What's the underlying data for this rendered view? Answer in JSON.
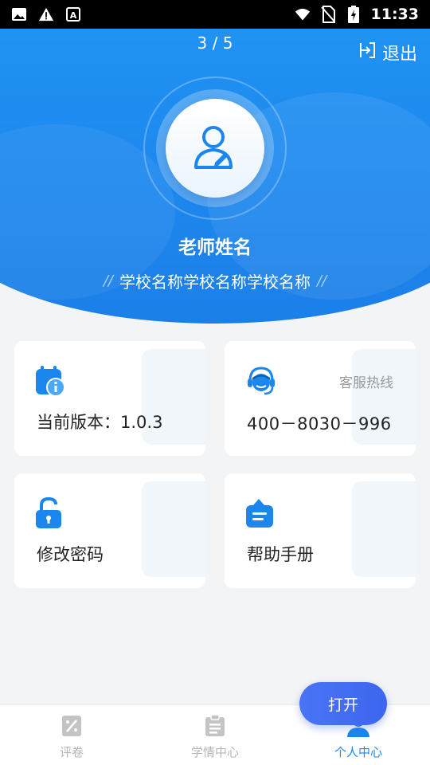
{
  "status_bar": {
    "time": "11:33",
    "left_icons": [
      "image-icon",
      "warning-icon",
      "font-icon"
    ],
    "right_icons": [
      "wifi-icon",
      "no-sim-icon",
      "battery-charging-icon"
    ]
  },
  "header": {
    "page_indicator": "3 / 5",
    "logout_label": "退出",
    "teacher_name": "老师姓名",
    "school_name": "学校名称学校名称学校名称"
  },
  "cards": {
    "version_label": "当前版本：1.0.3",
    "hotline_title": "客服热线",
    "hotline_number": "400－8030－996",
    "password_label": "修改密码",
    "help_label": "帮助手册"
  },
  "fab": {
    "label": "打开"
  },
  "tabs": [
    {
      "label": "评卷",
      "icon": "grading-icon",
      "active": false
    },
    {
      "label": "学情中心",
      "icon": "clipboard-icon",
      "active": false
    },
    {
      "label": "个人中心",
      "icon": "person-icon",
      "active": true
    }
  ],
  "colors": {
    "primary": "#1b86ee",
    "header_top": "#25a6f7",
    "fab": "#4a74f5",
    "background": "#f3f4f6"
  }
}
